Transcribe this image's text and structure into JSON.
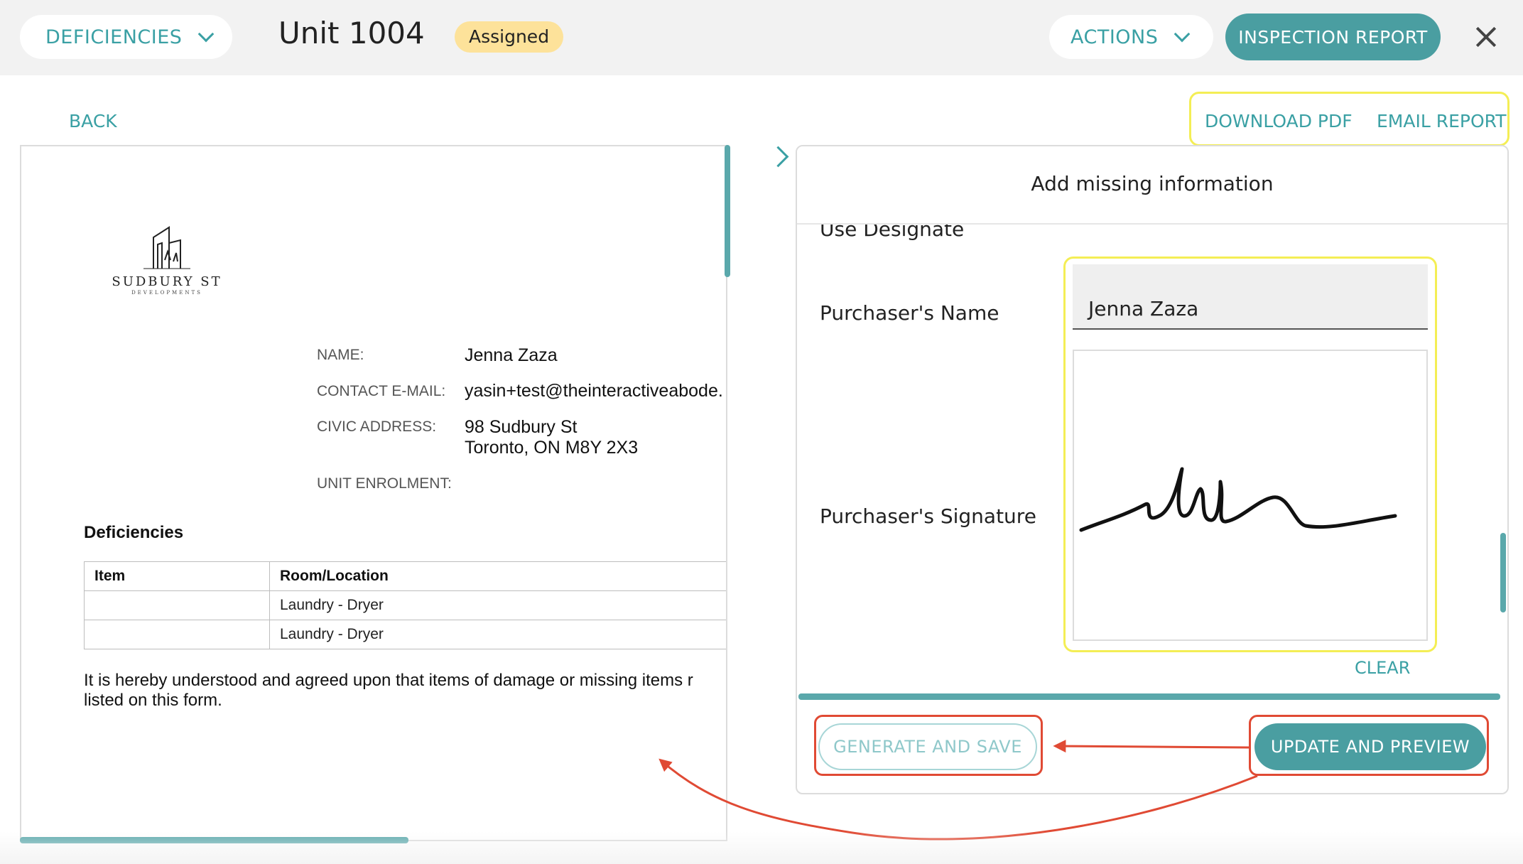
{
  "header": {
    "deficiencies_label": "DEFICIENCIES",
    "unit_title": "Unit 1004",
    "status_badge": "Assigned",
    "actions_label": "ACTIONS",
    "inspection_report_label": "INSPECTION REPORT"
  },
  "subheader": {
    "back_label": "BACK",
    "download_pdf_label": "DOWNLOAD PDF",
    "email_report_label": "EMAIL REPORT"
  },
  "document": {
    "logo_name": "SUDBURY ST",
    "logo_sub": "DEVELOPMENTS",
    "fields": {
      "name_label": "NAME:",
      "name_value": "Jenna Zaza",
      "email_label": "CONTACT E-MAIL:",
      "email_value": "yasin+test@theinteractiveabode.",
      "address_label": "CIVIC ADDRESS:",
      "address_line1": "98 Sudbury St",
      "address_line2": "Toronto, ON M8Y 2X3",
      "enrolment_label": "UNIT ENROLMENT:"
    },
    "deficiencies_title": "Deficiencies",
    "table": {
      "headers": [
        "Item",
        "Room/Location"
      ],
      "rows": [
        [
          "",
          "Laundry - Dryer"
        ],
        [
          "",
          "Laundry - Dryer"
        ]
      ]
    },
    "agreement_line1": "It is hereby understood and agreed upon that items of damage or missing items r",
    "agreement_line2": "listed on this form."
  },
  "panel": {
    "title": "Add missing information",
    "cut_label": "Use Designate",
    "purchaser_name_label": "Purchaser's Name",
    "purchaser_name_value": "Jenna Zaza",
    "purchaser_signature_label": "Purchaser's Signature",
    "clear_label": "CLEAR",
    "generate_label": "GENERATE AND SAVE",
    "update_label": "UPDATE AND PREVIEW"
  },
  "colors": {
    "accent": "#4a9ea1",
    "badge": "#fde29a",
    "highlight_yellow": "#f4ee55",
    "annotation_red": "#e04a34"
  }
}
